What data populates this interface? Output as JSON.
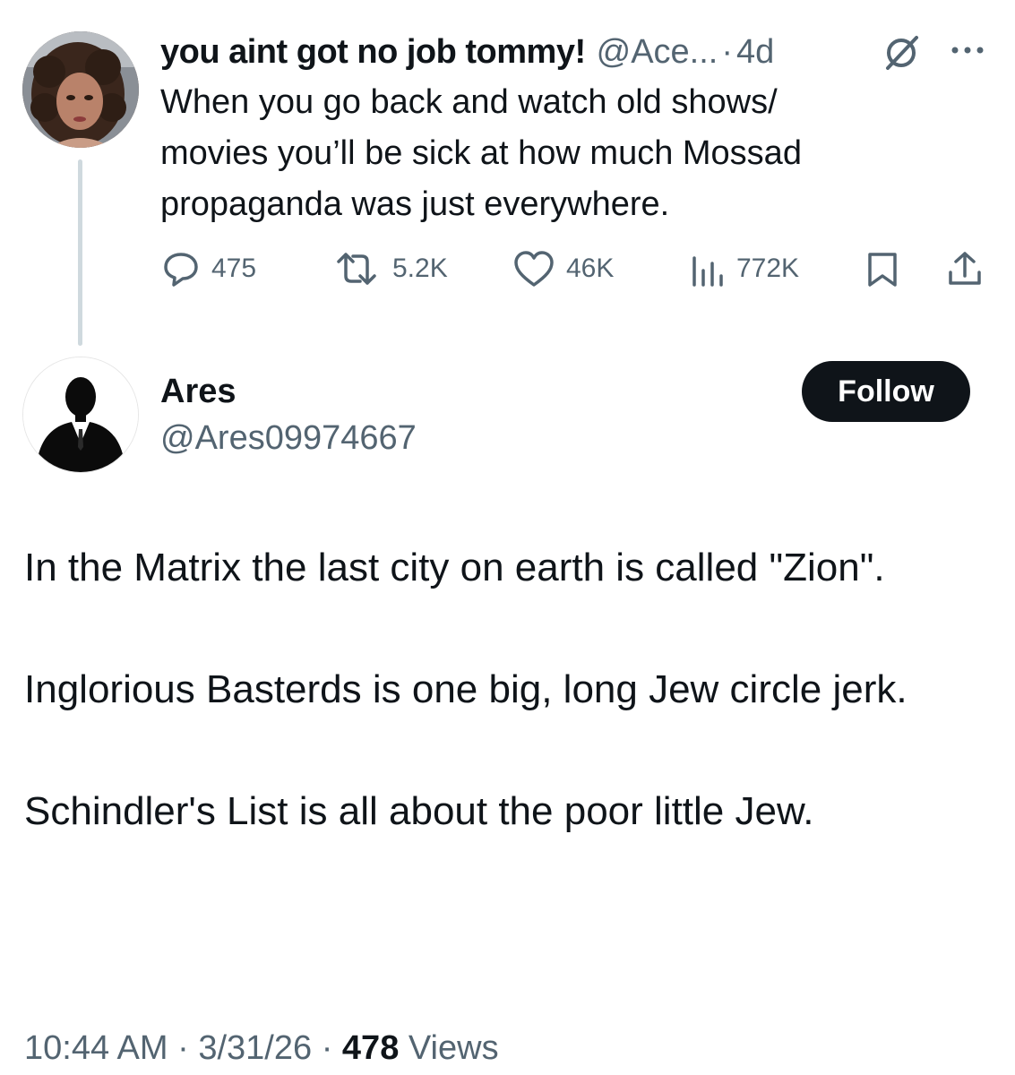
{
  "parent": {
    "name": "you aint got no job tommy!",
    "handle": "@Ace...",
    "separator": "·",
    "time": "4d",
    "text_lines": [
      "When you go back and watch old shows/",
      "movies you’ll be sick at how much Mossad",
      "propaganda was just everywhere."
    ],
    "stats": {
      "replies": "475",
      "reposts": "5.2K",
      "likes": "46K",
      "views": "772K"
    },
    "icons": [
      "avatar",
      "no-entry-badge-icon",
      "more-icon",
      "reply-icon",
      "repost-icon",
      "like-icon",
      "views-icon",
      "bookmark-icon",
      "share-icon"
    ]
  },
  "reply": {
    "name": "Ares",
    "handle": "@Ares09974667",
    "follow_label": "Follow",
    "paragraphs": [
      "In the Matrix the last city on earth is called \"Zion\".",
      "Inglorious Basterds is one big, long Jew circle jerk.",
      "Schindler's List is all about the poor little Jew."
    ],
    "time": "10:44 AM",
    "date": "3/31/26",
    "separator": "·",
    "views_count": "478",
    "views_label": "Views"
  },
  "colors": {
    "text": "#0f1419",
    "secondary": "#536471",
    "thread_line": "#cfd9de",
    "button_bg": "#0f1419"
  }
}
